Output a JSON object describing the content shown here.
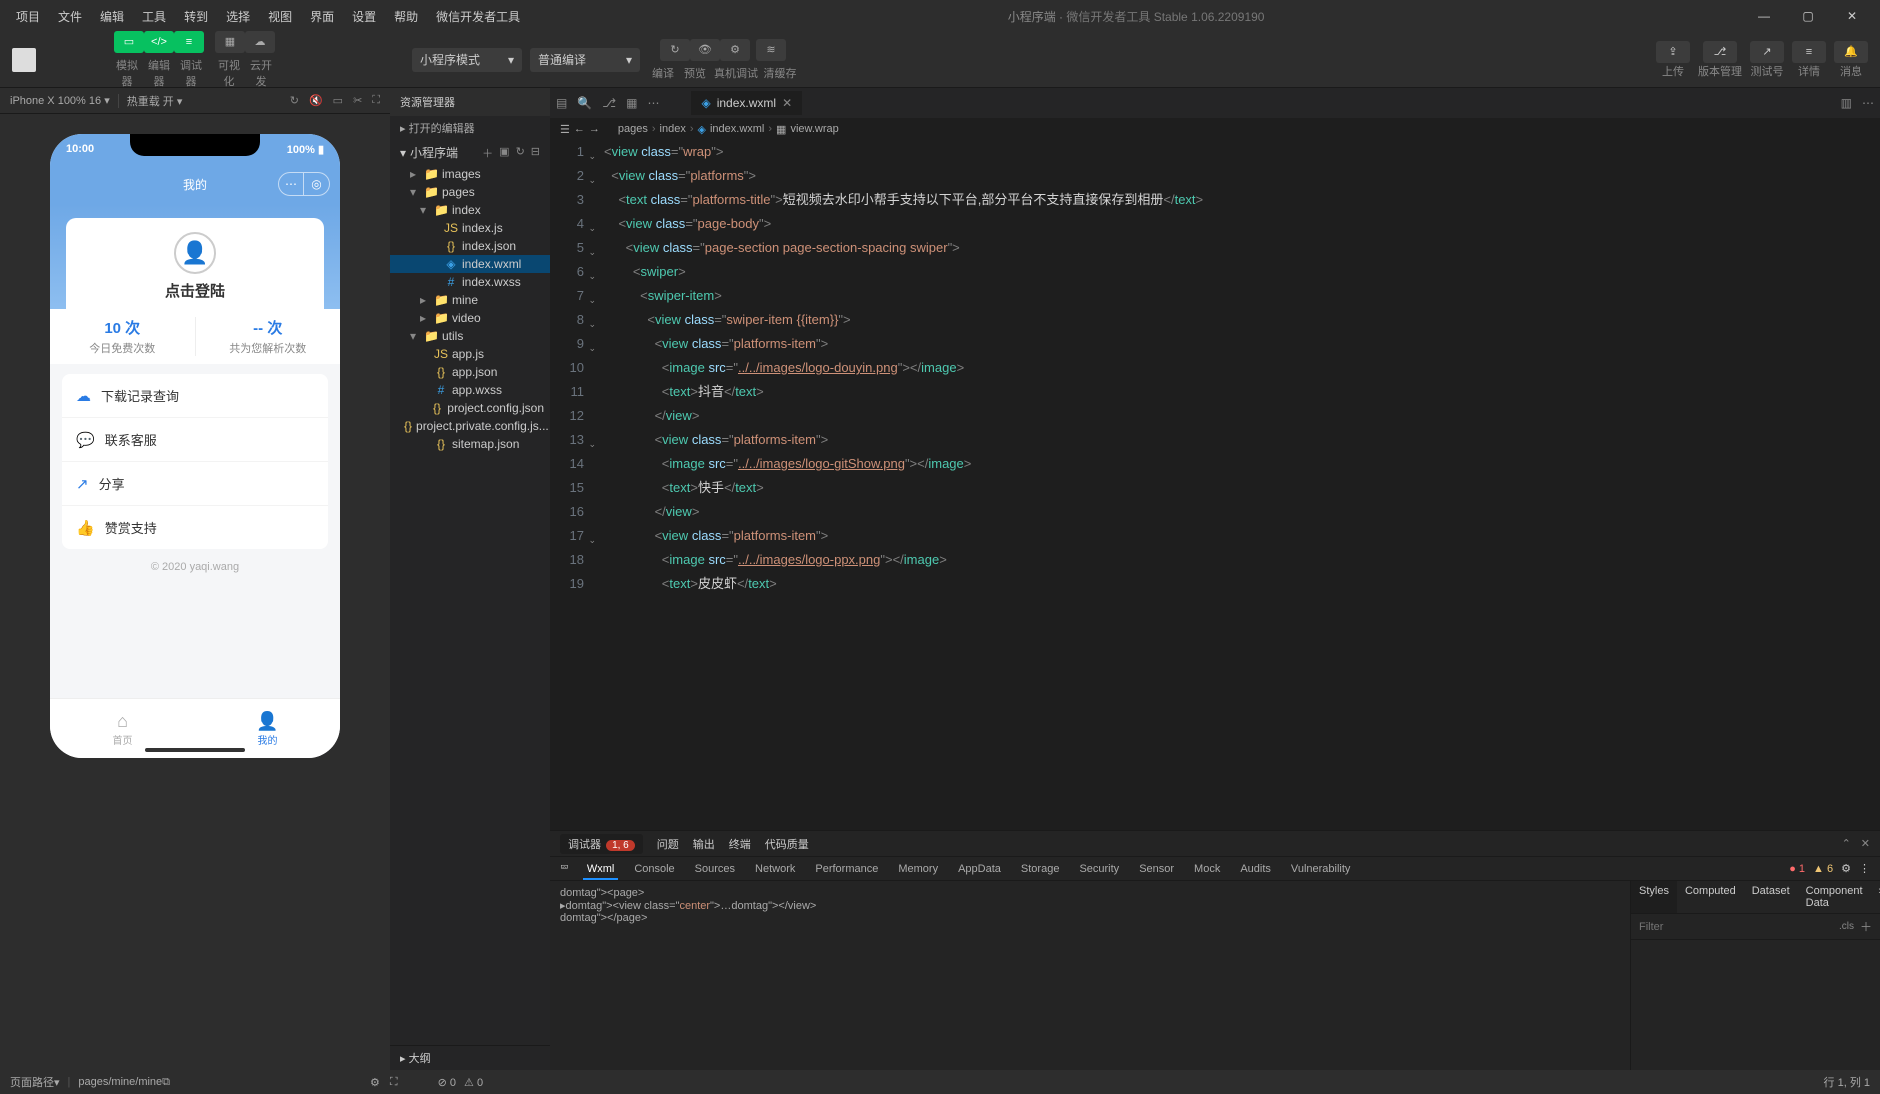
{
  "titlebar": {
    "menus": [
      "项目",
      "文件",
      "编辑",
      "工具",
      "转到",
      "选择",
      "视图",
      "界面",
      "设置",
      "帮助",
      "微信开发者工具"
    ],
    "center_left": "小程序端",
    "center_right": "微信开发者工具 Stable 1.06.2209190"
  },
  "toolbar": {
    "group1_labels": [
      "模拟器",
      "编辑器",
      "调试器"
    ],
    "group2_labels": [
      "可视化",
      "云开发"
    ],
    "mode_select": "小程序模式",
    "compile_select": "普通编译",
    "compile_group_labels": [
      "编译",
      "预览",
      "真机调试",
      "清缓存"
    ],
    "right_labels": [
      "上传",
      "版本管理",
      "测试号",
      "详情",
      "消息"
    ]
  },
  "simbar": {
    "device": "iPhone X 100% 16",
    "hot_reload": "热重载 开"
  },
  "phone": {
    "time": "10:00",
    "battery": "100%",
    "nav_title": "我的",
    "login": "点击登陆",
    "stat1_num": "10 次",
    "stat1_label": "今日免费次数",
    "stat2_num": "-- 次",
    "stat2_label": "共为您解析次数",
    "menu": [
      "下载记录查询",
      "联系客服",
      "分享",
      "赞赏支持"
    ],
    "copyright": "© 2020 yaqi.wang",
    "tab1": "首页",
    "tab2": "我的"
  },
  "explorer": {
    "title": "资源管理器",
    "open_editors": "打开的编辑器",
    "project": "小程序端",
    "outline": "大纲",
    "tree": [
      {
        "d": 1,
        "t": "folder",
        "label": "images",
        "exp": false
      },
      {
        "d": 1,
        "t": "folder",
        "label": "pages",
        "exp": true
      },
      {
        "d": 2,
        "t": "folder",
        "label": "index",
        "exp": true
      },
      {
        "d": 3,
        "t": "js",
        "label": "index.js"
      },
      {
        "d": 3,
        "t": "json",
        "label": "index.json"
      },
      {
        "d": 3,
        "t": "wxml",
        "label": "index.wxml",
        "sel": true
      },
      {
        "d": 3,
        "t": "wxss",
        "label": "index.wxss"
      },
      {
        "d": 2,
        "t": "folder",
        "label": "mine",
        "exp": false
      },
      {
        "d": 2,
        "t": "folder",
        "label": "video",
        "exp": false
      },
      {
        "d": 1,
        "t": "folder",
        "label": "utils",
        "exp": true
      },
      {
        "d": 2,
        "t": "js",
        "label": "app.js"
      },
      {
        "d": 2,
        "t": "json",
        "label": "app.json"
      },
      {
        "d": 2,
        "t": "wxss",
        "label": "app.wxss"
      },
      {
        "d": 2,
        "t": "json",
        "label": "project.config.json"
      },
      {
        "d": 2,
        "t": "json",
        "label": "project.private.config.js..."
      },
      {
        "d": 2,
        "t": "json",
        "label": "sitemap.json"
      }
    ]
  },
  "editor": {
    "tab": "index.wxml",
    "breadcrumb": [
      "pages",
      "index",
      "index.wxml",
      "view.wrap"
    ],
    "code": [
      {
        "n": 1,
        "i": 0,
        "fold": true,
        "segs": [
          [
            "pun",
            "<"
          ],
          [
            "tag",
            "view"
          ],
          [
            "text",
            " "
          ],
          [
            "attr",
            "class"
          ],
          [
            "pun",
            "=\""
          ],
          [
            "str",
            "wrap"
          ],
          [
            "pun",
            "\">"
          ]
        ]
      },
      {
        "n": 2,
        "i": 1,
        "fold": true,
        "segs": [
          [
            "pun",
            "<"
          ],
          [
            "tag",
            "view"
          ],
          [
            "text",
            " "
          ],
          [
            "attr",
            "class"
          ],
          [
            "pun",
            "=\""
          ],
          [
            "str",
            "platforms"
          ],
          [
            "pun",
            "\">"
          ]
        ]
      },
      {
        "n": 3,
        "i": 2,
        "segs": [
          [
            "pun",
            "<"
          ],
          [
            "tag",
            "text"
          ],
          [
            "text",
            " "
          ],
          [
            "attr",
            "class"
          ],
          [
            "pun",
            "=\""
          ],
          [
            "str",
            "platforms-title"
          ],
          [
            "pun",
            "\">"
          ],
          [
            "text",
            "短视频去水印小帮手支持以下平台,部分平台不支持直接保存到相册"
          ],
          [
            "pun",
            "</"
          ],
          [
            "tag",
            "text"
          ],
          [
            "pun",
            ">"
          ]
        ]
      },
      {
        "n": 4,
        "i": 2,
        "fold": true,
        "segs": [
          [
            "pun",
            "<"
          ],
          [
            "tag",
            "view"
          ],
          [
            "text",
            " "
          ],
          [
            "attr",
            "class"
          ],
          [
            "pun",
            "=\""
          ],
          [
            "str",
            "page-body"
          ],
          [
            "pun",
            "\">"
          ]
        ]
      },
      {
        "n": 5,
        "i": 3,
        "fold": true,
        "segs": [
          [
            "pun",
            "<"
          ],
          [
            "tag",
            "view"
          ],
          [
            "text",
            " "
          ],
          [
            "attr",
            "class"
          ],
          [
            "pun",
            "=\""
          ],
          [
            "str",
            "page-section page-section-spacing swiper"
          ],
          [
            "pun",
            "\">"
          ]
        ]
      },
      {
        "n": 6,
        "i": 4,
        "fold": true,
        "segs": [
          [
            "pun",
            "<"
          ],
          [
            "tag",
            "swiper"
          ],
          [
            "pun",
            ">"
          ]
        ]
      },
      {
        "n": 7,
        "i": 5,
        "fold": true,
        "segs": [
          [
            "pun",
            "<"
          ],
          [
            "tag",
            "swiper-item"
          ],
          [
            "pun",
            ">"
          ]
        ]
      },
      {
        "n": 8,
        "i": 6,
        "fold": true,
        "segs": [
          [
            "pun",
            "<"
          ],
          [
            "tag",
            "view"
          ],
          [
            "text",
            " "
          ],
          [
            "attr",
            "class"
          ],
          [
            "pun",
            "=\""
          ],
          [
            "str",
            "swiper-item {{item}}"
          ],
          [
            "pun",
            "\">"
          ]
        ]
      },
      {
        "n": 9,
        "i": 7,
        "fold": true,
        "segs": [
          [
            "pun",
            "<"
          ],
          [
            "tag",
            "view"
          ],
          [
            "text",
            " "
          ],
          [
            "attr",
            "class"
          ],
          [
            "pun",
            "=\""
          ],
          [
            "str",
            "platforms-item"
          ],
          [
            "pun",
            "\">"
          ]
        ]
      },
      {
        "n": 10,
        "i": 8,
        "segs": [
          [
            "pun",
            "<"
          ],
          [
            "tag",
            "image"
          ],
          [
            "text",
            " "
          ],
          [
            "attr",
            "src"
          ],
          [
            "pun",
            "=\""
          ],
          [
            "stru",
            "../../images/logo-douyin.png"
          ],
          [
            "pun",
            "\"></"
          ],
          [
            "tag",
            "image"
          ],
          [
            "pun",
            ">"
          ]
        ]
      },
      {
        "n": 11,
        "i": 8,
        "segs": [
          [
            "pun",
            "<"
          ],
          [
            "tag",
            "text"
          ],
          [
            "pun",
            ">"
          ],
          [
            "text",
            "抖音"
          ],
          [
            "pun",
            "</"
          ],
          [
            "tag",
            "text"
          ],
          [
            "pun",
            ">"
          ]
        ]
      },
      {
        "n": 12,
        "i": 7,
        "segs": [
          [
            "pun",
            "</"
          ],
          [
            "tag",
            "view"
          ],
          [
            "pun",
            ">"
          ]
        ]
      },
      {
        "n": 13,
        "i": 7,
        "fold": true,
        "segs": [
          [
            "pun",
            "<"
          ],
          [
            "tag",
            "view"
          ],
          [
            "text",
            " "
          ],
          [
            "attr",
            "class"
          ],
          [
            "pun",
            "=\""
          ],
          [
            "str",
            "platforms-item"
          ],
          [
            "pun",
            "\">"
          ]
        ]
      },
      {
        "n": 14,
        "i": 8,
        "segs": [
          [
            "pun",
            "<"
          ],
          [
            "tag",
            "image"
          ],
          [
            "text",
            " "
          ],
          [
            "attr",
            "src"
          ],
          [
            "pun",
            "=\""
          ],
          [
            "stru",
            "../../images/logo-gitShow.png"
          ],
          [
            "pun",
            "\"></"
          ],
          [
            "tag",
            "image"
          ],
          [
            "pun",
            ">"
          ]
        ]
      },
      {
        "n": 15,
        "i": 8,
        "segs": [
          [
            "pun",
            "<"
          ],
          [
            "tag",
            "text"
          ],
          [
            "pun",
            ">"
          ],
          [
            "text",
            "快手"
          ],
          [
            "pun",
            "</"
          ],
          [
            "tag",
            "text"
          ],
          [
            "pun",
            ">"
          ]
        ]
      },
      {
        "n": 16,
        "i": 7,
        "segs": [
          [
            "pun",
            "</"
          ],
          [
            "tag",
            "view"
          ],
          [
            "pun",
            ">"
          ]
        ]
      },
      {
        "n": 17,
        "i": 7,
        "fold": true,
        "segs": [
          [
            "pun",
            "<"
          ],
          [
            "tag",
            "view"
          ],
          [
            "text",
            " "
          ],
          [
            "attr",
            "class"
          ],
          [
            "pun",
            "=\""
          ],
          [
            "str",
            "platforms-item"
          ],
          [
            "pun",
            "\">"
          ]
        ]
      },
      {
        "n": 18,
        "i": 8,
        "segs": [
          [
            "pun",
            "<"
          ],
          [
            "tag",
            "image"
          ],
          [
            "text",
            " "
          ],
          [
            "attr",
            "src"
          ],
          [
            "pun",
            "=\""
          ],
          [
            "stru",
            "../../images/logo-ppx.png"
          ],
          [
            "pun",
            "\"></"
          ],
          [
            "tag",
            "image"
          ],
          [
            "pun",
            ">"
          ]
        ]
      },
      {
        "n": 19,
        "i": 8,
        "segs": [
          [
            "pun",
            "<"
          ],
          [
            "tag",
            "text"
          ],
          [
            "pun",
            ">"
          ],
          [
            "text",
            "皮皮虾"
          ],
          [
            "pun",
            "</"
          ],
          [
            "tag",
            "text"
          ],
          [
            "pun",
            ">"
          ]
        ]
      }
    ]
  },
  "debugger": {
    "main_tabs": [
      "调试器",
      "问题",
      "输出",
      "终端",
      "代码质量"
    ],
    "badge": "1, 6",
    "devtools_tabs": [
      "Wxml",
      "Console",
      "Sources",
      "Network",
      "Performance",
      "Memory",
      "AppData",
      "Storage",
      "Security",
      "Sensor",
      "Mock",
      "Audits",
      "Vulnerability"
    ],
    "err_count": "1",
    "warn_count": "6",
    "dom_lines": [
      "<page>",
      "▸<view class=\"center\">…</view>",
      "</page>"
    ],
    "style_tabs": [
      "Styles",
      "Computed",
      "Dataset",
      "Component Data"
    ],
    "filter_placeholder": "Filter",
    "cls": ".cls"
  },
  "status": {
    "page_path_label": "页面路径",
    "page_path": "pages/mine/mine",
    "warn0": "0",
    "err0": "0",
    "position": "行 1, 列 1"
  }
}
